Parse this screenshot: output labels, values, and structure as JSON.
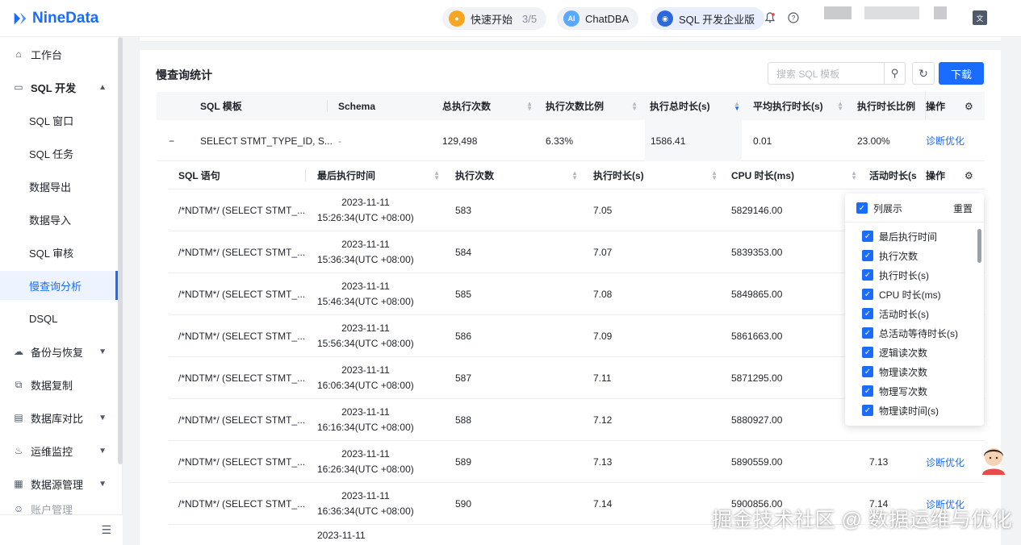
{
  "app": {
    "logo_text": "NineData",
    "brand_color": "#1a6cff"
  },
  "header": {
    "quick_start": {
      "label": "快速开始",
      "progress": "3/5"
    },
    "chatdba": {
      "label": "ChatDBA",
      "badge": "AI"
    },
    "edition": {
      "label": "SQL 开发企业版"
    },
    "icons": [
      "bell-icon",
      "help-icon",
      "language-icon"
    ]
  },
  "sidebar": {
    "items": [
      {
        "label": "工作台",
        "icon": "home-icon"
      },
      {
        "label": "SQL 开发",
        "icon": "monitor-icon",
        "expanded": true
      },
      {
        "label": "SQL 窗口"
      },
      {
        "label": "SQL 任务"
      },
      {
        "label": "数据导出"
      },
      {
        "label": "数据导入"
      },
      {
        "label": "SQL 审核"
      },
      {
        "label": "慢查询分析",
        "active": true
      },
      {
        "label": "DSQL"
      },
      {
        "label": "备份与恢复",
        "icon": "backup-icon"
      },
      {
        "label": "数据复制",
        "icon": "replicate-icon"
      },
      {
        "label": "数据库对比",
        "icon": "compare-icon"
      },
      {
        "label": "运维监控",
        "icon": "alarm-icon"
      },
      {
        "label": "数据源管理",
        "icon": "datasource-icon"
      },
      {
        "label": "账户管理",
        "icon": "account-icon"
      }
    ]
  },
  "main": {
    "title": "慢查询统计",
    "search_placeholder": "搜索 SQL 模板",
    "download_label": "下载",
    "columns": [
      "SQL 模板",
      "Schema",
      "总执行次数",
      "执行次数比例",
      "执行总时长(s)",
      "平均执行时长(s)",
      "执行时长比例",
      "操作"
    ],
    "row": {
      "expand": "−",
      "template": "SELECT STMT_TYPE_ID, S...",
      "schema": "-",
      "total_exec": "129,498",
      "exec_ratio": "6.33%",
      "total_time": "1586.41",
      "avg_time": "0.01",
      "time_ratio": "23.00%",
      "action": "诊断优化"
    },
    "sub_columns": [
      "SQL 语句",
      "最后执行时间",
      "执行次数",
      "执行时长(s)",
      "CPU 时长(ms)",
      "活动时长(s",
      "操作"
    ],
    "sub_rows": [
      {
        "sql": "/*NDTM*/ (SELECT STMT_...",
        "date": "2023-11-11",
        "time": "15:26:34(UTC +08:00)",
        "count": "583",
        "dur": "7.05",
        "cpu": "5829146.00",
        "active": "",
        "action": ""
      },
      {
        "sql": "/*NDTM*/ (SELECT STMT_...",
        "date": "2023-11-11",
        "time": "15:36:34(UTC +08:00)",
        "count": "584",
        "dur": "7.07",
        "cpu": "5839353.00",
        "active": "",
        "action": ""
      },
      {
        "sql": "/*NDTM*/ (SELECT STMT_...",
        "date": "2023-11-11",
        "time": "15:46:34(UTC +08:00)",
        "count": "585",
        "dur": "7.08",
        "cpu": "5849865.00",
        "active": "",
        "action": ""
      },
      {
        "sql": "/*NDTM*/ (SELECT STMT_...",
        "date": "2023-11-11",
        "time": "15:56:34(UTC +08:00)",
        "count": "586",
        "dur": "7.09",
        "cpu": "5861663.00",
        "active": "",
        "action": ""
      },
      {
        "sql": "/*NDTM*/ (SELECT STMT_...",
        "date": "2023-11-11",
        "time": "16:06:34(UTC +08:00)",
        "count": "587",
        "dur": "7.11",
        "cpu": "5871295.00",
        "active": "",
        "action": ""
      },
      {
        "sql": "/*NDTM*/ (SELECT STMT_...",
        "date": "2023-11-11",
        "time": "16:16:34(UTC +08:00)",
        "count": "588",
        "dur": "7.12",
        "cpu": "5880927.00",
        "active": "",
        "action": ""
      },
      {
        "sql": "/*NDTM*/ (SELECT STMT_...",
        "date": "2023-11-11",
        "time": "16:26:34(UTC +08:00)",
        "count": "589",
        "dur": "7.13",
        "cpu": "5890559.00",
        "active": "7.13",
        "action": "诊断优化"
      },
      {
        "sql": "/*NDTM*/ (SELECT STMT_...",
        "date": "2023-11-11",
        "time": "16:36:34(UTC +08:00)",
        "count": "590",
        "dur": "7.14",
        "cpu": "5900856.00",
        "active": "7.14",
        "action": "诊断优化"
      },
      {
        "sql": "/*NDTM*/ (SELECT STMT_...",
        "date": "2023-11-11",
        "time": "",
        "count": "",
        "dur": "",
        "cpu": "",
        "active": "",
        "action": ""
      }
    ],
    "column_popup": {
      "header": "列展示",
      "reset": "重置",
      "items": [
        "最后执行时间",
        "执行次数",
        "执行时长(s)",
        "CPU 时长(ms)",
        "活动时长(s)",
        "总活动等待时长(s)",
        "逻辑读次数",
        "物理读次数",
        "物理写次数",
        "物理读时间(s)"
      ]
    }
  },
  "watermark": "掘金技术社区 @ 数据运维与优化"
}
